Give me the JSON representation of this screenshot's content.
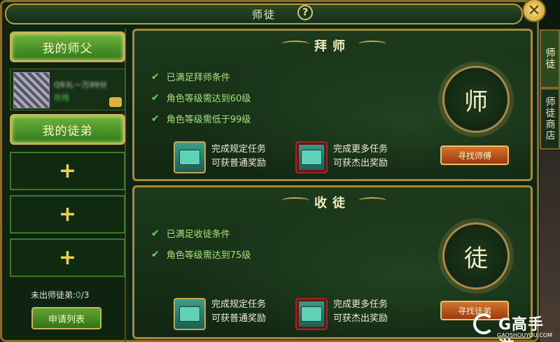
{
  "window": {
    "title": "师徒"
  },
  "side_tabs": [
    {
      "label": "师徒"
    },
    {
      "label": "师徒商店"
    }
  ],
  "left": {
    "my_master_label": "我的师父",
    "master": {
      "name": "Q93L一万99分",
      "status": "在线"
    },
    "my_apprentice_label": "我的徒弟",
    "slot_symbol": "+",
    "unfinished_label": "未出师徒弟:",
    "unfinished_count": "0",
    "unfinished_total": "/3",
    "apply_list_label": "申请列表"
  },
  "mentor_panel": {
    "title": "拜师",
    "conditions": [
      "已满足拜师条件",
      "角色等级需达到60级",
      "角色等级需低于99级"
    ],
    "reward1_line1": "完成规定任务",
    "reward1_line2": "可获普通奖励",
    "reward2_line1": "完成更多任务",
    "reward2_line2": "可获杰出奖励",
    "seal_char": "师",
    "action_label": "寻找师傅"
  },
  "apprentice_panel": {
    "title": "收徒",
    "conditions": [
      "已满足收徒条件",
      "角色等级需达到75级"
    ],
    "reward1_line1": "完成规定任务",
    "reward1_line2": "可获普通奖励",
    "reward2_line1": "完成更多任务",
    "reward2_line2": "可获杰出奖励",
    "seal_char": "徒",
    "action_label": "寻找徒弟"
  },
  "watermark": {
    "brand": "G高手游",
    "url": "GAOSHOUYOU.COM"
  }
}
